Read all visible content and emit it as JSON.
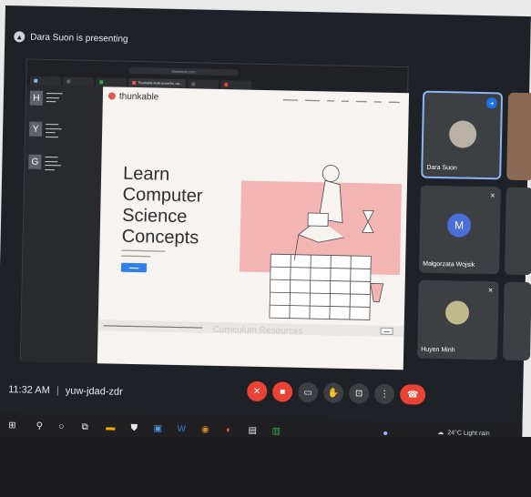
{
  "meet": {
    "presenting_text": "Dara Suon is presenting",
    "time": "11:32 AM",
    "separator": "|",
    "meeting_code": "yuw-jdad-zdr"
  },
  "browser": {
    "address": "thunkable.com",
    "tabs": [
      "",
      "",
      "",
      "Thunkable Build powerful, nat...",
      "",
      ""
    ]
  },
  "sidepanel": {
    "items": [
      {
        "letter": "H"
      },
      {
        "letter": "Y"
      },
      {
        "letter": "G"
      }
    ]
  },
  "thunkable": {
    "logo_text": "thunkable",
    "hero_lines": [
      "Learn",
      "Computer",
      "Science",
      "Concepts"
    ],
    "curriculum_watermark": "Curriculum Resources"
  },
  "participants": [
    {
      "name": "Dara Suon",
      "initial": ""
    },
    {
      "name": "Małgorzata Wojsik",
      "initial": "M"
    },
    {
      "name": "Huyen Minh",
      "initial": ""
    }
  ],
  "taskbar": {
    "weather": "24°C Light rain"
  },
  "colors": {
    "meet_bg": "#1e2227",
    "hangup": "#ea4335",
    "accent_blue": "#1a73e8",
    "thunkable_red": "#e6544e",
    "hero_pink": "#f2b5b3"
  },
  "icons": {
    "presenting": "presentation-icon",
    "mic_off": "mic-off-icon",
    "camera_off": "camera-off-icon",
    "captions": "captions-icon",
    "raise_hand": "raise-hand-icon",
    "present_screen": "present-screen-icon",
    "more": "more-options-icon",
    "hangup": "hang-up-icon"
  }
}
